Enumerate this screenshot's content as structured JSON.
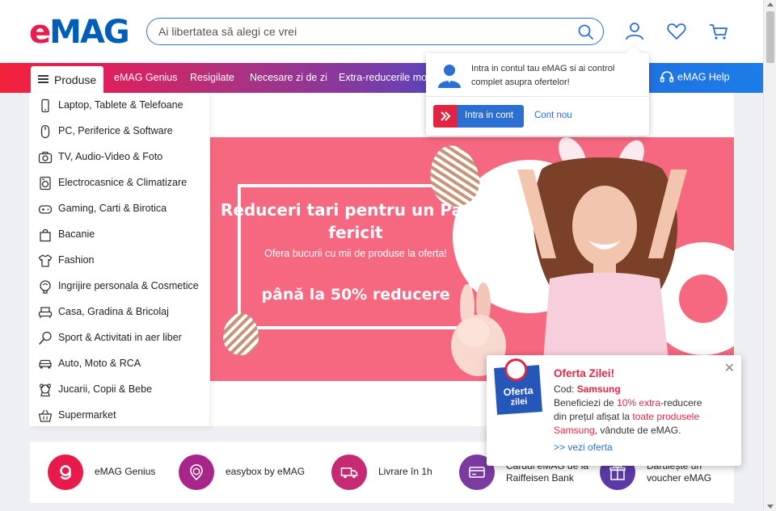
{
  "header": {
    "logo_e": "e",
    "logo_rest": "MAG",
    "search_placeholder": "Ai libertatea să alegi ce vrei",
    "icons": [
      "search-icon",
      "user-icon",
      "heart-icon",
      "cart-icon"
    ]
  },
  "nav": {
    "produse_label": "Produse",
    "links": [
      "eMAG Genius",
      "Resigilate",
      "Necesare zi de zi",
      "Extra-reducerile mon"
    ],
    "help_label": "eMAG Help"
  },
  "categories": [
    {
      "label": "Laptop, Tablete & Telefoane",
      "icon": "phone-icon"
    },
    {
      "label": "PC, Periferice & Software",
      "icon": "mouse-icon"
    },
    {
      "label": "TV, Audio-Video & Foto",
      "icon": "camera-icon"
    },
    {
      "label": "Electrocasnice & Climatizare",
      "icon": "washing-machine-icon"
    },
    {
      "label": "Gaming, Carti & Birotica",
      "icon": "gamepad-icon"
    },
    {
      "label": "Bacanie",
      "icon": "shopping-bag-icon"
    },
    {
      "label": "Fashion",
      "icon": "tshirt-icon"
    },
    {
      "label": "Ingrijire personala & Cosmetice",
      "icon": "cosmetics-icon"
    },
    {
      "label": "Casa, Gradina & Bricolaj",
      "icon": "armchair-icon"
    },
    {
      "label": "Sport & Activitati in aer liber",
      "icon": "racket-icon"
    },
    {
      "label": "Auto, Moto & RCA",
      "icon": "car-icon"
    },
    {
      "label": "Jucarii, Copii & Bebe",
      "icon": "teddy-bear-icon"
    },
    {
      "label": "Supermarket",
      "icon": "basket-icon"
    }
  ],
  "account_popup": {
    "message": "Intra in contul tau eMAG si ai control complet asupra ofertelor!",
    "login_label": "Intra in cont",
    "new_account_label": "Cont nou"
  },
  "banner": {
    "title": "Reduceri tari pentru un Paște fericit",
    "subtitle": "Ofera bucurii cu mii de produse la oferta!",
    "discount": "până la 50% reducere"
  },
  "features": [
    {
      "label": "eMAG Genius",
      "icon": "genius-icon",
      "color": "#e8194b"
    },
    {
      "label": "easybox by eMAG",
      "icon": "easybox-icon",
      "color": "#a8268a"
    },
    {
      "label": "Livrare în 1h",
      "icon": "truck-icon",
      "color": "#c62a72"
    },
    {
      "label": "Cardul eMAG de la Raiffeisen Bank",
      "icon": "card-icon",
      "color": "#7b3a9e"
    },
    {
      "label": "Dăruiește un voucher eMAG",
      "icon": "gift-icon",
      "color": "#5b3aa6"
    }
  ],
  "oferta": {
    "badge_line1": "Oferta",
    "badge_line2": "zilei",
    "title": "Oferta Zilei!",
    "code_label": "Cod:",
    "code_value": "Samsung",
    "line1": "Beneficiezi de",
    "extra": "10% extra",
    "line1b": "-reducere",
    "line2": "din prețul afișat la",
    "toate": "toate produsele",
    "samsung": "Samsung",
    "line3": ", vândute de eMAG.",
    "link": ">> vezi oferta"
  },
  "colors": {
    "brand_red": "#e22443",
    "brand_blue": "#2a6fd1",
    "banner_pink": "#f5687f"
  }
}
